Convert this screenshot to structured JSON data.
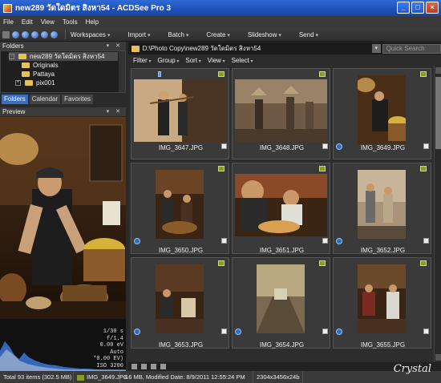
{
  "window": {
    "title": "new289 วัดใดมิตร สิงหา54 - ACDSee Pro 3"
  },
  "menu": [
    "File",
    "Edit",
    "View",
    "Tools",
    "Help"
  ],
  "toolbar": [
    "Workspaces",
    "Import",
    "Batch",
    "Create",
    "Slideshow",
    "Send"
  ],
  "folders": {
    "title": "Folders",
    "items": [
      {
        "label": "new289 วัดใดมิตร สิงหา54",
        "expander": "-",
        "selected": true
      },
      {
        "label": "Originals",
        "expander": ""
      },
      {
        "label": "Pattaya",
        "expander": ""
      },
      {
        "label": "pix001",
        "expander": "+"
      }
    ]
  },
  "panel_tabs": [
    "Folders",
    "Calendar",
    "Favorites"
  ],
  "preview": {
    "title": "Preview",
    "info": [
      "1/30 s",
      "f/1.4",
      "0.00 eV",
      "Auto",
      "*0.00 EV)",
      "ISO 3200"
    ]
  },
  "path": "D:\\Photo Copy\\new289 วัดใดมิตร สิงหา54",
  "search_placeholder": "Quick Search",
  "filterbar": [
    "Filter",
    "Group",
    "Sort",
    "View",
    "Select"
  ],
  "thumbnails": [
    {
      "name": "IMG_3647.JPG"
    },
    {
      "name": "IMG_3648.JPG"
    },
    {
      "name": "IMG_3649.JPG"
    },
    {
      "name": "IMG_3650.JPG"
    },
    {
      "name": "IMG_3651.JPG"
    },
    {
      "name": "IMG_3652.JPG"
    },
    {
      "name": "IMG_3653.JPG"
    },
    {
      "name": "IMG_3654.JPG"
    },
    {
      "name": "IMG_3655.JPG"
    }
  ],
  "status": {
    "total": "Total 93 items  (302.5 MB)",
    "file": "IMG_3649.JPG",
    "details": "3.6 MB, Modified Date: 8/9/2011 12:55:24 PM",
    "dims": "2304x3456x24b"
  },
  "watermark": "Crystal",
  "colors": {
    "accent": "#3d6fbf",
    "titlebar": "#2358c9",
    "badge": "#8a9a2a"
  }
}
